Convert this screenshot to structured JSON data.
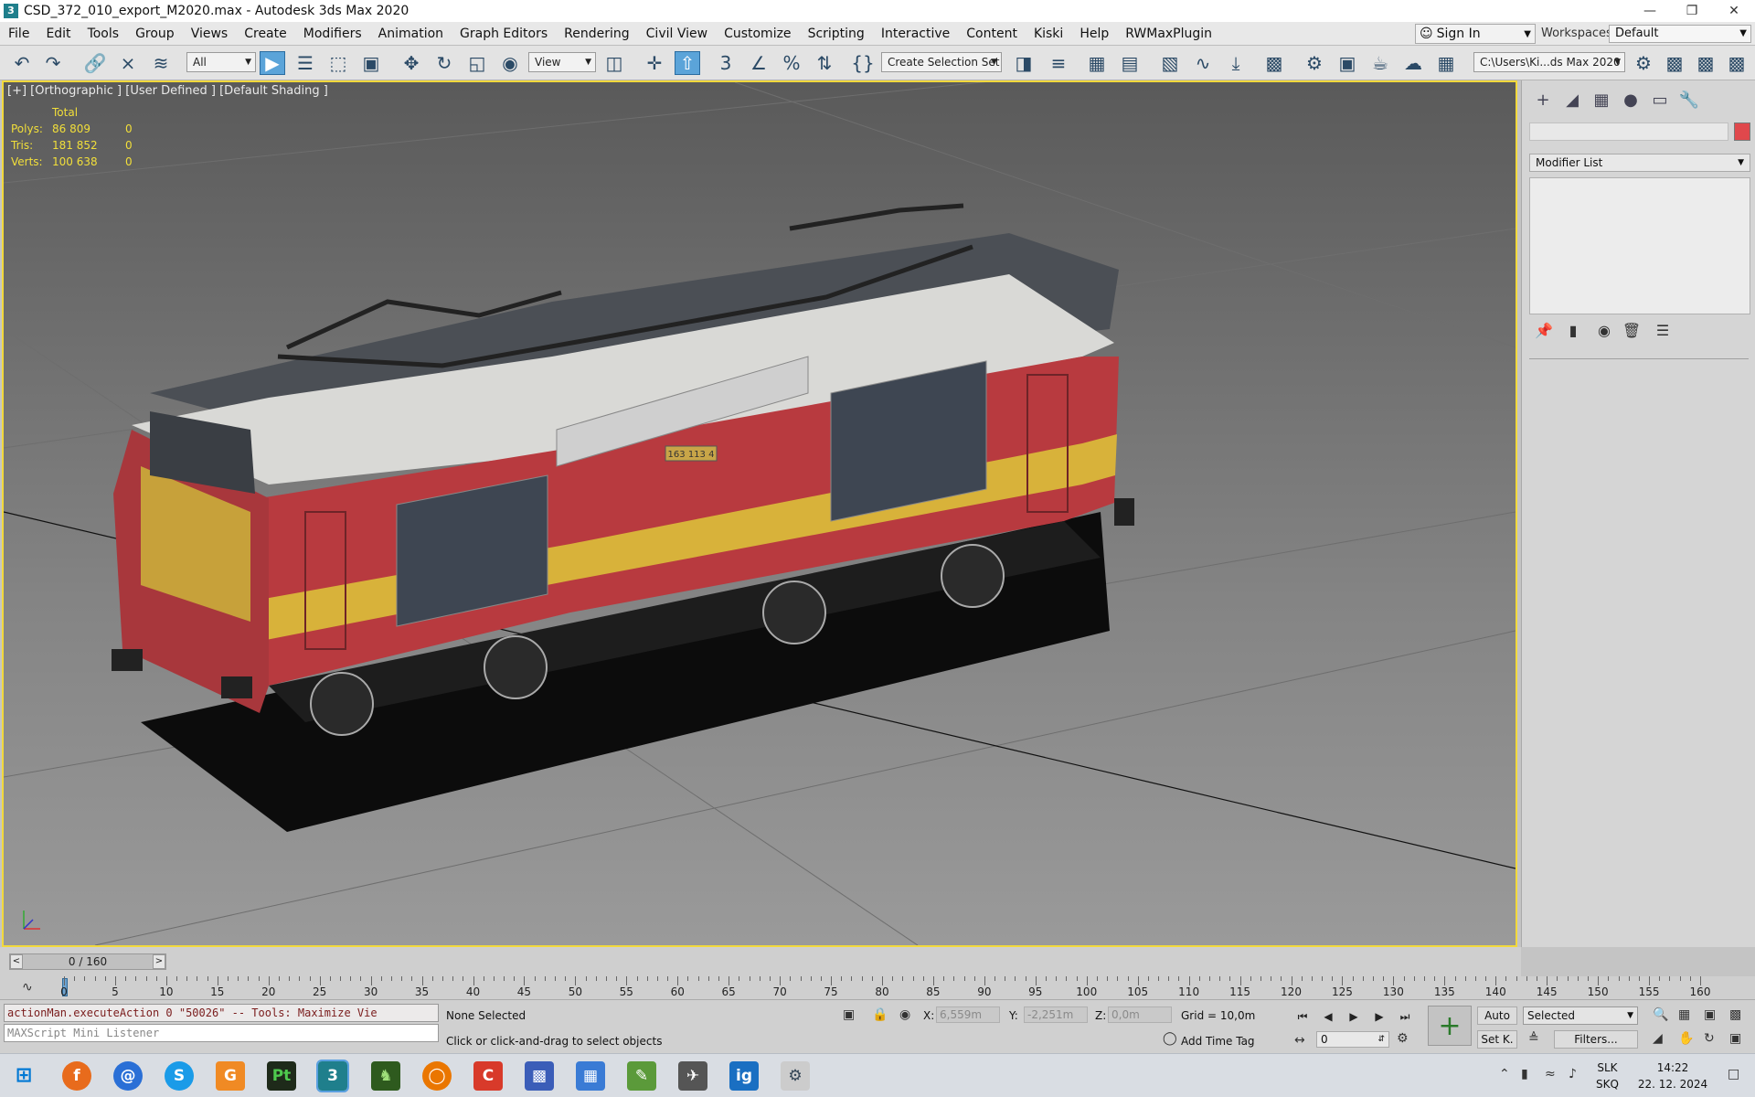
{
  "window": {
    "title": "CSD_372_010_export_M2020.max - Autodesk 3ds Max 2020",
    "app_icon": "3",
    "controls": [
      "—",
      "❐",
      "✕"
    ]
  },
  "menubar": {
    "items": [
      "File",
      "Edit",
      "Tools",
      "Group",
      "Views",
      "Create",
      "Modifiers",
      "Animation",
      "Graph Editors",
      "Rendering",
      "Civil View",
      "Customize",
      "Scripting",
      "Interactive",
      "Content",
      "Kiski",
      "Help",
      "RWMaxPlugin"
    ],
    "signin": "Sign In",
    "workspaces_label": "Workspaces:",
    "workspace": "Default"
  },
  "toolbar": {
    "selection_filter": "All",
    "ref_coord": "View",
    "named_selection": "Create Selection Set",
    "project_path": "C:\\Users\\Ki...ds Max 2020"
  },
  "viewport": {
    "label": "[+] [Orthographic ] [User Defined ] [Default Shading ]",
    "stats": {
      "header": "Total",
      "rows": [
        {
          "label": "Polys:",
          "total": "86 809",
          "sel": "0"
        },
        {
          "label": "Tris:",
          "total": "181 852",
          "sel": "0"
        },
        {
          "label": "Verts:",
          "total": "100 638",
          "sel": "0"
        }
      ]
    },
    "locomotive_number": "163 113 4",
    "colors": {
      "border": "#f2d93c",
      "body_red": "#b83a3f",
      "stripe_yellow": "#d8b23a"
    }
  },
  "command_panel": {
    "modifier_list": "Modifier List"
  },
  "timeslider": {
    "frame": "0 / 160",
    "prev": "<",
    "next": ">"
  },
  "trackbar": {
    "labels": [
      "0",
      "5",
      "10",
      "15",
      "20",
      "25",
      "30",
      "35",
      "40",
      "45",
      "50",
      "55",
      "60",
      "65",
      "70",
      "75",
      "80",
      "85",
      "90",
      "95",
      "100",
      "105",
      "110",
      "115",
      "120",
      "125",
      "130",
      "135",
      "140",
      "145",
      "150",
      "155",
      "160"
    ]
  },
  "status": {
    "maxscript_output": "actionMan.executeAction 0 \"50026\"  -- Tools: Maximize Vie",
    "maxscript_input": "MAXScript Mini Listener",
    "selection": "None Selected",
    "prompt": "Click or click-and-drag to select objects",
    "x_label": "X:",
    "x_value": "6,559m",
    "y_label": "Y:",
    "y_value": "-2,251m",
    "z_label": "Z:",
    "z_value": "0,0m",
    "grid": "Grid = 10,0m",
    "add_time_tag": "Add Time Tag",
    "auto_key": "Auto",
    "selected": "Selected",
    "set_key": "Set K.",
    "filters": "Filters...",
    "frame_value": "0"
  },
  "taskbar": {
    "lang_top": "SLK",
    "lang_bottom": "SKQ",
    "time": "14:22",
    "date": "22. 12. 2024"
  }
}
